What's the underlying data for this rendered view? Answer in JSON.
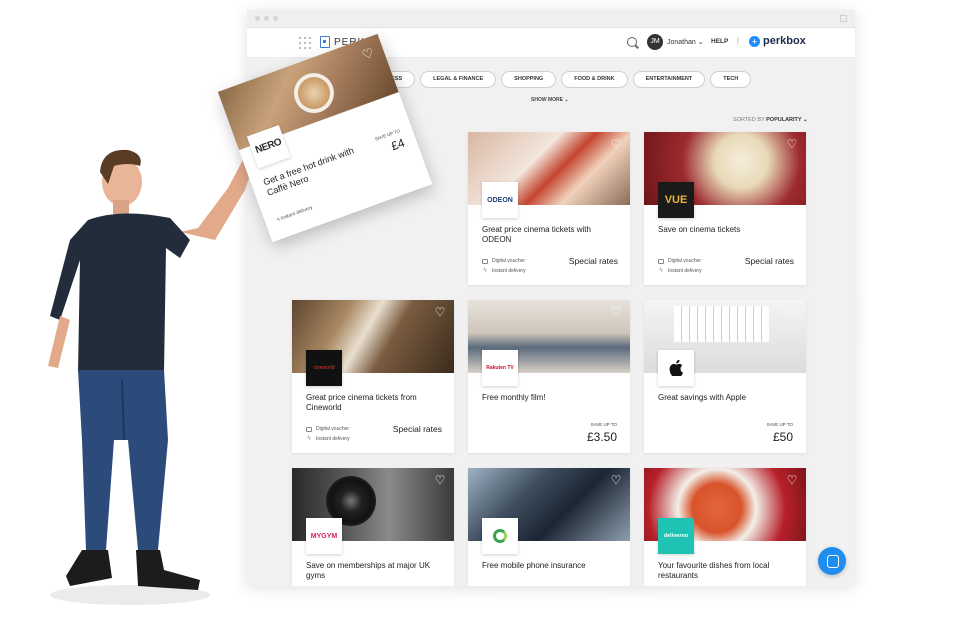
{
  "header": {
    "brand": "PERKS",
    "avatar_initials": "JM",
    "user_name": "Jonathan ⌄",
    "help": "HELP",
    "divider": "|",
    "partner": "perkbox"
  },
  "categories": [
    "HEALTH & FITNESS",
    "LEGAL & FINANCE",
    "SHOPPING",
    "FOOD & DRINK",
    "ENTERTAINMENT",
    "TECH"
  ],
  "show_more": "SHOW MORE ⌄",
  "sort": {
    "prefix": "SORTED BY",
    "value": "POPULARITY ⌄"
  },
  "floating_card": {
    "logo": "NERO",
    "title": "Get a free hot drink with Caffè Nero",
    "save_label": "SAVE UP TO",
    "price": "£4",
    "delivery": "Instant delivery"
  },
  "cards": [
    {
      "brand": "ODEON",
      "title": "Great price cinema tickets with ODEON",
      "meta1": "Digital voucher",
      "meta2": "Instant delivery",
      "rate": "Special rates"
    },
    {
      "brand": "VUE",
      "title": "Save on cinema tickets",
      "meta1": "Digital voucher",
      "meta2": "Instant delivery",
      "rate": "Special rates"
    },
    {
      "brand": "cineworld",
      "title": "Great price cinema tickets from Cineworld",
      "meta1": "Digital voucher",
      "meta2": "Instant delivery",
      "rate": "Special rates"
    },
    {
      "brand": "Rakuten TV",
      "title": "Free monthly film!",
      "save_label": "SAVE UP TO",
      "price": "£3.50"
    },
    {
      "brand": "",
      "title": "Great savings with Apple",
      "save_label": "SAVE UP TO",
      "price": "£50"
    },
    {
      "brand": "MYGYM",
      "title": "Save on memberships at major UK gyms"
    },
    {
      "brand": "",
      "title": "Free mobile phone insurance"
    },
    {
      "brand": "deliveroo",
      "title": "Your favourite dishes from local restaurants"
    }
  ],
  "colors": {
    "accent": "#1f8ded",
    "brand_blue": "#3b7dd8",
    "vue_gold": "#e8b33b",
    "deliveroo": "#1ec3b3",
    "rakuten_red": "#c8102e"
  }
}
